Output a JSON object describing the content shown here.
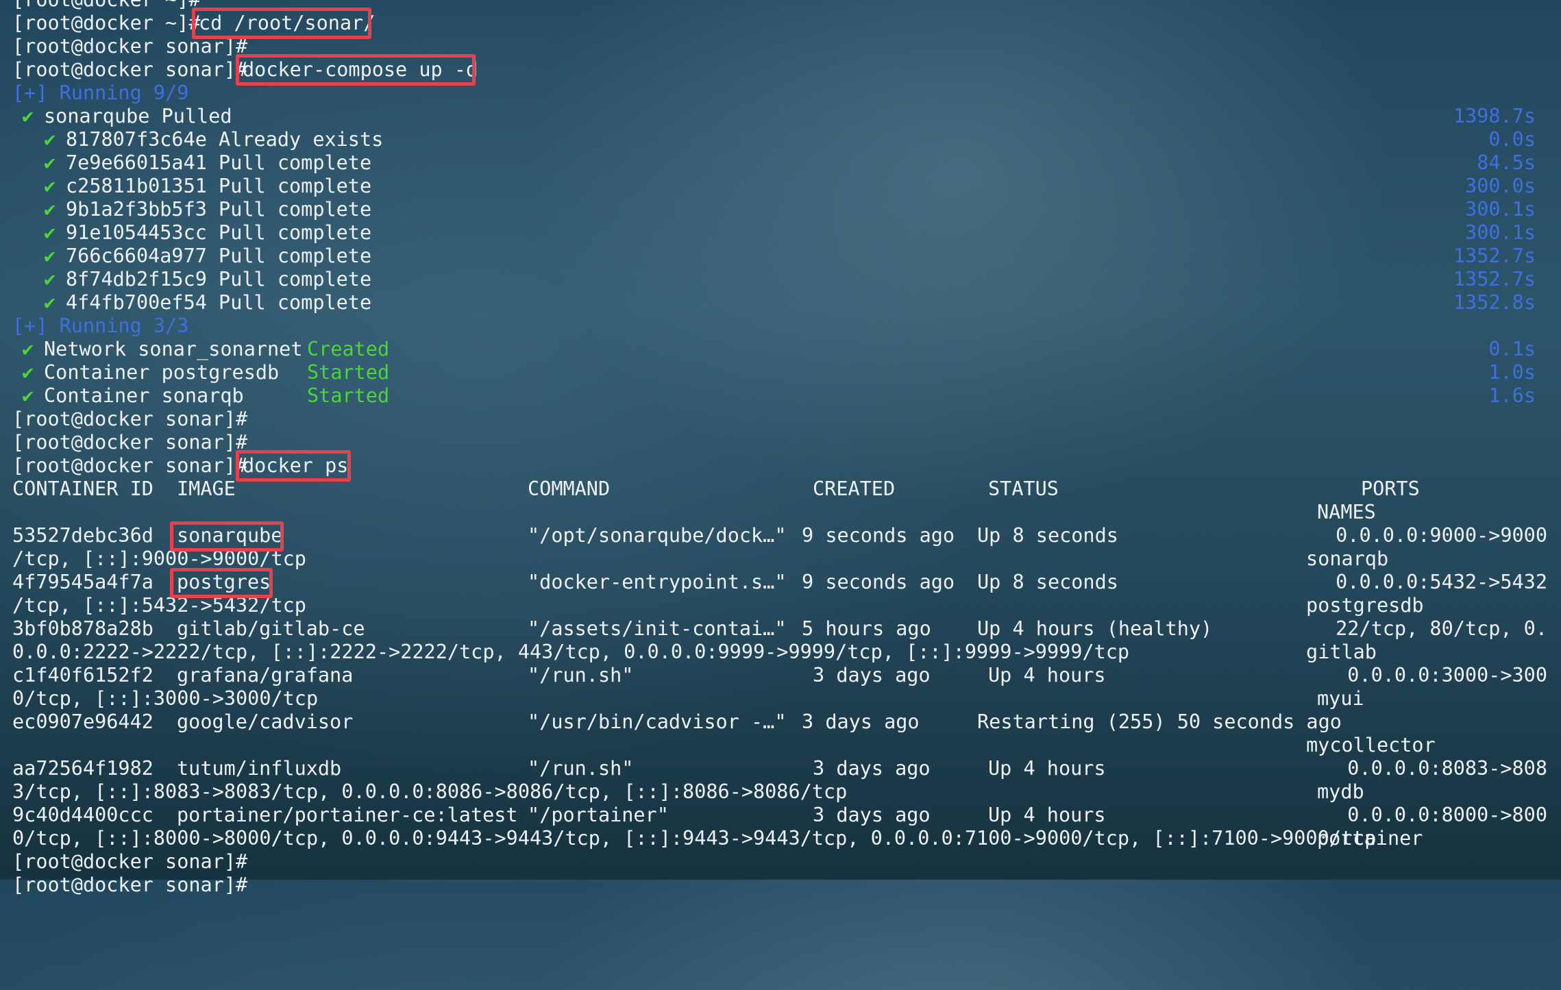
{
  "prompt_user": "[root@docker ~]#",
  "prompt_sonar": "[root@docker sonar]#",
  "commands": {
    "cd": "cd /root/sonar/",
    "compose": "docker-compose up -d",
    "ps": "docker ps"
  },
  "check_glyph": "✔",
  "pull": {
    "running_label": "[+] Running 9/9",
    "title": "sonarqube Pulled",
    "title_time": "1398.7s",
    "layers": [
      {
        "text": "817807f3c64e Already exists",
        "time": "0.0s"
      },
      {
        "text": "7e9e66015a41 Pull complete",
        "time": "84.5s"
      },
      {
        "text": "c25811b01351 Pull complete",
        "time": "300.0s"
      },
      {
        "text": "9b1a2f3bb5f3 Pull complete",
        "time": "300.1s"
      },
      {
        "text": "91e1054453cc Pull complete",
        "time": "300.1s"
      },
      {
        "text": "766c6604a977 Pull complete",
        "time": "1352.7s"
      },
      {
        "text": "8f74db2f15c9 Pull complete",
        "time": "1352.7s"
      },
      {
        "text": "4f4fb700ef54 Pull complete",
        "time": "1352.8s"
      }
    ]
  },
  "up": {
    "running_label": "[+] Running 3/3",
    "items": [
      {
        "name": "Network sonar_sonarnet",
        "status": "Created",
        "time": "0.1s"
      },
      {
        "name": "Container postgresdb",
        "status": "Started",
        "time": "1.0s"
      },
      {
        "name": "Container sonarqb",
        "status": "Started",
        "time": "1.6s"
      }
    ]
  },
  "ps": {
    "headers": {
      "id": "CONTAINER ID",
      "image": "IMAGE",
      "command": "COMMAND",
      "created": "CREATED",
      "status": "STATUS",
      "ports": "PORTS",
      "names": "NAMES"
    },
    "rows": [
      {
        "id": "53527debc36d",
        "image": "sonarqube",
        "command": "\"/opt/sonarqube/dock…\"",
        "created": "9 seconds ago",
        "status": "Up 8 seconds",
        "ports_head": "0.0.0.0:9000->9000",
        "ports_tail": "/tcp, [::]:9000->9000/tcp",
        "name": "sonarqb"
      },
      {
        "id": "4f79545a4f7a",
        "image": "postgres",
        "command": "\"docker-entrypoint.s…\"",
        "created": "9 seconds ago",
        "status": "Up 8 seconds",
        "ports_head": "0.0.0.0:5432->5432",
        "ports_tail": "/tcp, [::]:5432->5432/tcp",
        "name": "postgresdb"
      },
      {
        "id": "3bf0b878a28b",
        "image": "gitlab/gitlab-ce",
        "command": "\"/assets/init-contai…\"",
        "created": "5 hours ago",
        "status": "Up 4 hours (healthy)",
        "ports_head": "22/tcp, 80/tcp, 0.",
        "ports_tail": "0.0.0:2222->2222/tcp, [::]:2222->2222/tcp, 443/tcp, 0.0.0.0:9999->9999/tcp, [::]:9999->9999/tcp",
        "name": "gitlab"
      },
      {
        "id": "c1f40f6152f2",
        "image": "grafana/grafana",
        "command": "\"/run.sh\"",
        "created": "3 days ago",
        "status": "Up 4 hours",
        "ports_head": "0.0.0.0:3000->300",
        "ports_tail": "0/tcp, [::]:3000->3000/tcp",
        "name": "myui"
      },
      {
        "id": "ec0907e96442",
        "image": "google/cadvisor",
        "command": "\"/usr/bin/cadvisor -…\"",
        "created": "3 days ago",
        "status": "Restarting (255) 50 seconds ago",
        "ports_head": "",
        "ports_tail": "",
        "name": "mycollector"
      },
      {
        "id": "aa72564f1982",
        "image": "tutum/influxdb",
        "command": "\"/run.sh\"",
        "created": "3 days ago",
        "status": "Up 4 hours",
        "ports_head": "0.0.0.0:8083->808",
        "ports_tail": "3/tcp, [::]:8083->8083/tcp, 0.0.0.0:8086->8086/tcp, [::]:8086->8086/tcp",
        "name": "mydb"
      },
      {
        "id": "9c40d4400ccc",
        "image": "portainer/portainer-ce:latest",
        "command": "\"/portainer\"",
        "created": "3 days ago",
        "status": "Up 4 hours",
        "ports_head": "0.0.0.0:8000->800",
        "ports_tail": "0/tcp, [::]:8000->8000/tcp, 0.0.0.0:9443->9443/tcp, [::]:9443->9443/tcp, 0.0.0.0:7100->9000/tcp, [::]:7100->9000/tcp",
        "name": "portainer"
      }
    ]
  }
}
